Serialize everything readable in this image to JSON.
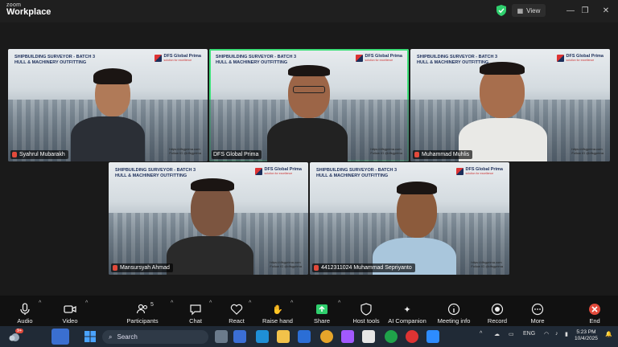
{
  "app": {
    "brand_small": "zoom",
    "brand_large": "Workplace"
  },
  "titlebar": {
    "view_label": "View",
    "minimize": "—",
    "restore": "❐",
    "close": "✕"
  },
  "slide": {
    "header_line1": "SHIPBUILDING SURVEYOR - BATCH 3",
    "header_line2": "HULL & MACHINERY OUTFITTING",
    "logo_text": "DFS Global Prima",
    "logo_sub": "solution for excellence",
    "url_line1": "https://dfsgprima.com",
    "url_line2": "Follow IG @dfsgprima"
  },
  "participants": [
    {
      "name": "Syahrul Mubarakh"
    },
    {
      "name": "DFS Global Prima"
    },
    {
      "name": "Muhammad Muhlis"
    },
    {
      "name": "Mansursyah Ahmad"
    },
    {
      "name": "4412311024 Muhammad Sepriyanto"
    }
  ],
  "toolbar": {
    "audio": "Audio",
    "video": "Video",
    "participants": "Participants",
    "participants_count": "5",
    "chat": "Chat",
    "react": "React",
    "raise_hand": "Raise hand",
    "share": "Share",
    "host_tools": "Host tools",
    "ai_companion": "AI Companion",
    "meeting_info": "Meeting info",
    "record": "Record",
    "more": "More",
    "end": "End"
  },
  "taskbar": {
    "search_placeholder": "Search",
    "language": "ENG",
    "time": "5:23 PM",
    "date": "10/4/2025",
    "weather_badge": "9+"
  },
  "colors": {
    "active_speaker": "#3ee07a",
    "end_red": "#e24a3b",
    "share_green": "#2fcf6d"
  }
}
